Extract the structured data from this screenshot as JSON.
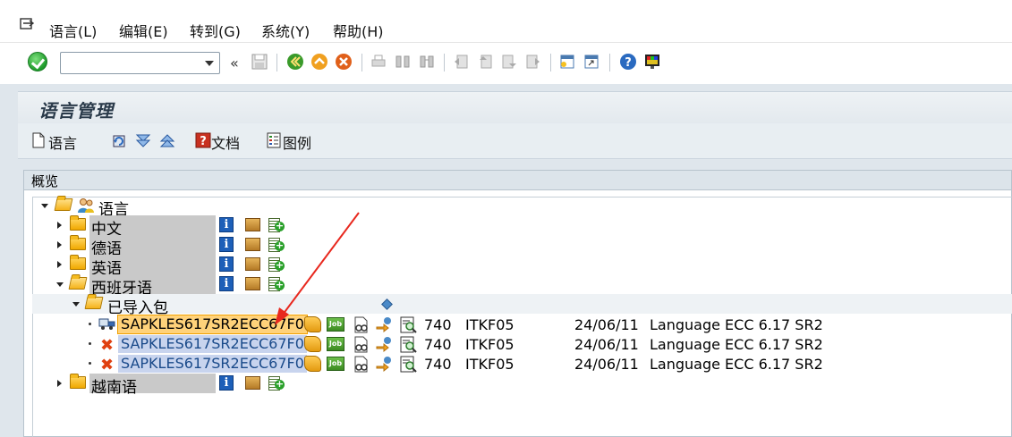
{
  "menu": {
    "items": [
      {
        "label": "语言(L)"
      },
      {
        "label": "编辑(E)"
      },
      {
        "label": "转到(G)"
      },
      {
        "label": "系统(Y)"
      },
      {
        "label": "帮助(H)"
      }
    ]
  },
  "toolbar": {
    "command_field_value": "",
    "nav_glyph": "«"
  },
  "page": {
    "title": "语言管理"
  },
  "app_toolbar": {
    "language_label": "语言",
    "document_label": "文档",
    "legend_label": "图例"
  },
  "overview": {
    "header": "概览",
    "root_label": "语言",
    "languages": [
      {
        "label": "中文",
        "expanded": false
      },
      {
        "label": "德语",
        "expanded": false
      },
      {
        "label": "英语",
        "expanded": false
      },
      {
        "label": "西班牙语",
        "expanded": true
      },
      {
        "label": "越南语",
        "expanded": false
      }
    ],
    "imported_folder": "已导入包",
    "packages": [
      {
        "name": "SAPKLES617SR2ECC67F0",
        "status": "truck-icon",
        "client": "740",
        "user": "ITKF05",
        "date": "24/06/11",
        "desc": "Language ECC 6.17 SR2",
        "focused": true
      },
      {
        "name": "SAPKLES617SR2ECC67F0",
        "status": "error-x-icon",
        "client": "740",
        "user": "ITKF05",
        "date": "24/06/11",
        "desc": "Language ECC 6.17 SR2",
        "focused": false
      },
      {
        "name": "SAPKLES617SR2ECC67F0",
        "status": "error-x-icon",
        "client": "740",
        "user": "ITKF05",
        "date": "24/06/11",
        "desc": "Language ECC 6.17 SR2",
        "focused": false
      }
    ]
  },
  "colors": {
    "annotation_arrow": "#e8281e",
    "focus_highlight": "#ffd27a",
    "selection_bg": "#c8d4ee"
  }
}
